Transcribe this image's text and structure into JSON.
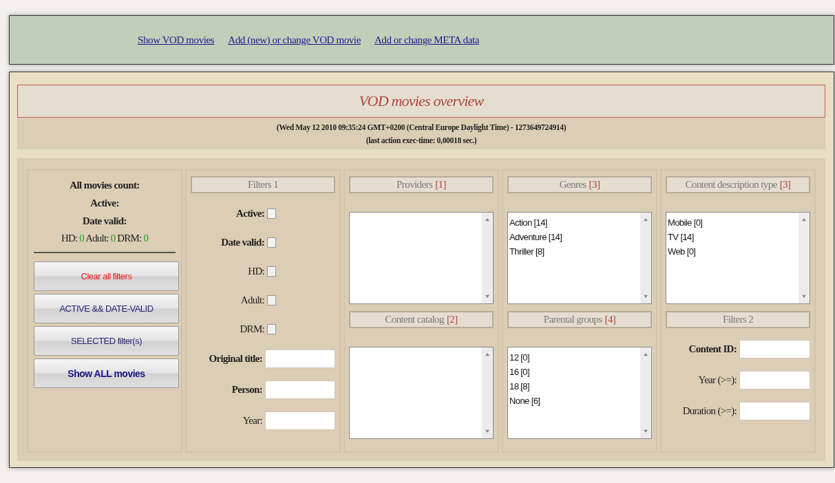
{
  "nav": {
    "links": [
      "Show VOD movies",
      "Add (new) or change VOD movie",
      "Add or change META data"
    ]
  },
  "header": {
    "title": "VOD movies overview",
    "timestamp": "(Wed May 12 2010 09:35:24 GMT+0200 (Central Europe Daylight Time) - 1273649724914)",
    "exec_time": "(last action exec-time: 0,00018 sec.)"
  },
  "stats": {
    "lines": [
      "All movies count:",
      "Active:",
      "Date valid:"
    ],
    "counts": [
      {
        "label": "HD:",
        "value": "0"
      },
      {
        "label": "Adult:",
        "value": "0"
      },
      {
        "label": "DRM:",
        "value": "0"
      }
    ]
  },
  "buttons": [
    {
      "label": "Clear all filters",
      "kind": "clear"
    },
    {
      "label": "ACTIVE && DATE-VALID",
      "kind": "normal"
    },
    {
      "label": "SELECTED filter(s)",
      "kind": "normal"
    },
    {
      "label": "Show ALL movies",
      "kind": "strong"
    }
  ],
  "filters1": {
    "title": "Filters 1",
    "checkboxes": [
      {
        "label": "Active:",
        "bold": true,
        "checked": false
      },
      {
        "label": "Date valid:",
        "bold": true,
        "checked": false
      },
      {
        "label": "HD:",
        "bold": false,
        "checked": false
      },
      {
        "label": "Adult:",
        "bold": false,
        "checked": false
      },
      {
        "label": "DRM:",
        "bold": false,
        "checked": false
      }
    ],
    "fields": [
      {
        "label": "Original title:",
        "bold": true
      },
      {
        "label": "Person:",
        "bold": true
      },
      {
        "label": "Year:",
        "bold": false
      }
    ]
  },
  "lists": [
    {
      "title": "Providers",
      "count": "[1]"
    },
    {
      "title": "Genres",
      "count": "[3]",
      "items": [
        "Action [14]",
        "Adventure [14]",
        "Thriller [8]"
      ]
    },
    {
      "title": "Content description type",
      "count": "[3]",
      "items": [
        "Mobile [0]",
        "TV [14]",
        "Web [0]"
      ]
    },
    {
      "title": "Content catalog",
      "count": "[2]"
    },
    {
      "title": "Parental groups",
      "count": "[4]",
      "items": [
        "12 [0]",
        "16 [0]",
        "18 [8]",
        "None [6]"
      ]
    }
  ],
  "filters2": {
    "title": "Filters 2",
    "fields": [
      {
        "label": "Content ID:",
        "bold": true
      },
      {
        "label": "Year (>=):",
        "bold": false
      },
      {
        "label": "Duration (>=):",
        "bold": false
      }
    ]
  }
}
